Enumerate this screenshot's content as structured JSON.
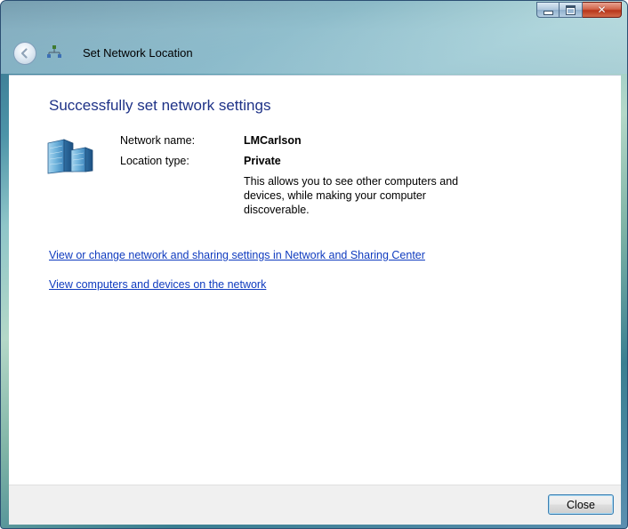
{
  "window": {
    "title": "Set Network Location"
  },
  "content": {
    "heading": "Successfully set network settings",
    "network_name_label": "Network name:",
    "network_name_value": "LMCarlson",
    "location_type_label": "Location type:",
    "location_type_value": "Private",
    "description": "This allows you to see other computers and devices, while making your computer discoverable.",
    "links": [
      "View or change network and sharing settings in Network and Sharing Center",
      "View computers and devices on the network"
    ]
  },
  "footer": {
    "close_label": "Close"
  },
  "colors": {
    "heading": "#1e3287",
    "link": "#0f3bbf",
    "close_caption": "#c2472a"
  }
}
